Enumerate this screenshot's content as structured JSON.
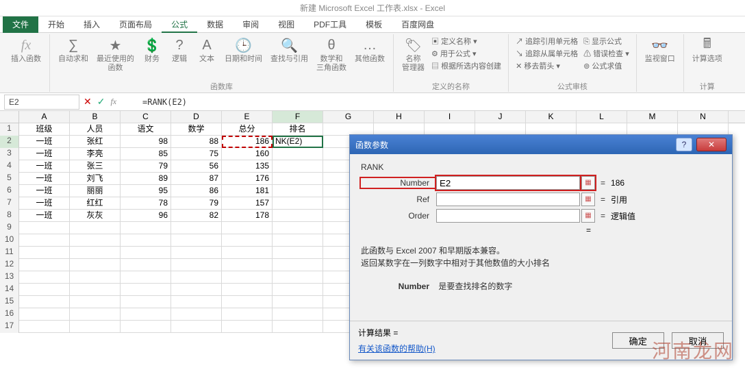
{
  "window": {
    "title": "新建 Microsoft Excel 工作表.xlsx - Excel"
  },
  "tabs": {
    "file": "文件",
    "items": [
      "开始",
      "插入",
      "页面布局",
      "公式",
      "数据",
      "审阅",
      "视图",
      "PDF工具",
      "模板",
      "百度网盘"
    ],
    "active_index": 3
  },
  "ribbon": {
    "insert_fn": "插入函数",
    "autosum": "自动求和",
    "recent": "最近使用的\n函数",
    "financial": "财务",
    "logical": "逻辑",
    "text": "文本",
    "datetime": "日期和时间",
    "lookup": "查找与引用",
    "math": "数学和\n三角函数",
    "more": "其他函数",
    "group_lib": "函数库",
    "name_mgr": "名称\n管理器",
    "def1": "定义名称",
    "def2": "用于公式",
    "def3": "根据所选内容创建",
    "group_names": "定义的名称",
    "aud1": "追踪引用单元格",
    "aud2": "追踪从属单元格",
    "aud3": "移去箭头",
    "aud4": "显示公式",
    "aud5": "错误检查",
    "aud6": "公式求值",
    "group_audit": "公式审核",
    "watch": "监视窗口",
    "calc": "计算选项",
    "group_calc": "计算"
  },
  "namebox": {
    "ref": "E2"
  },
  "formula_bar": {
    "text": "=RANK(E2)"
  },
  "columns": [
    "A",
    "B",
    "C",
    "D",
    "E",
    "F",
    "G",
    "H",
    "I",
    "J",
    "K",
    "L",
    "M",
    "N"
  ],
  "headers": {
    "A": "班级",
    "B": "人员",
    "C": "语文",
    "D": "数学",
    "E": "总分",
    "F": "排名"
  },
  "cell_F2_display": "NK(E2)",
  "rows": [
    {
      "A": "一班",
      "B": "张红",
      "C": "98",
      "D": "88",
      "E": "186"
    },
    {
      "A": "一班",
      "B": "李亮",
      "C": "85",
      "D": "75",
      "E": "160"
    },
    {
      "A": "一班",
      "B": "张三",
      "C": "79",
      "D": "56",
      "E": "135"
    },
    {
      "A": "一班",
      "B": "刘飞",
      "C": "89",
      "D": "87",
      "E": "176"
    },
    {
      "A": "一班",
      "B": "丽丽",
      "C": "95",
      "D": "86",
      "E": "181"
    },
    {
      "A": "一班",
      "B": "红红",
      "C": "78",
      "D": "79",
      "E": "157"
    },
    {
      "A": "一班",
      "B": "灰灰",
      "C": "96",
      "D": "82",
      "E": "178"
    }
  ],
  "dialog": {
    "title": "函数参数",
    "fn": "RANK",
    "args": {
      "number": {
        "label": "Number",
        "value": "E2",
        "result": "186"
      },
      "ref": {
        "label": "Ref",
        "value": "",
        "result": "引用"
      },
      "order": {
        "label": "Order",
        "value": "",
        "result": "逻辑值"
      }
    },
    "eq_partial": "=",
    "desc1": "此函数与 Excel 2007 和早期版本兼容。",
    "desc2": "返回某数字在一列数字中相对于其他数值的大小排名",
    "arg_help_name": "Number",
    "arg_help_text": "是要查找排名的数字",
    "result_label": "计算结果 =",
    "help_link": "有关该函数的帮助(H)",
    "ok": "确定",
    "cancel": "取消"
  },
  "watermark": "河南龙网"
}
